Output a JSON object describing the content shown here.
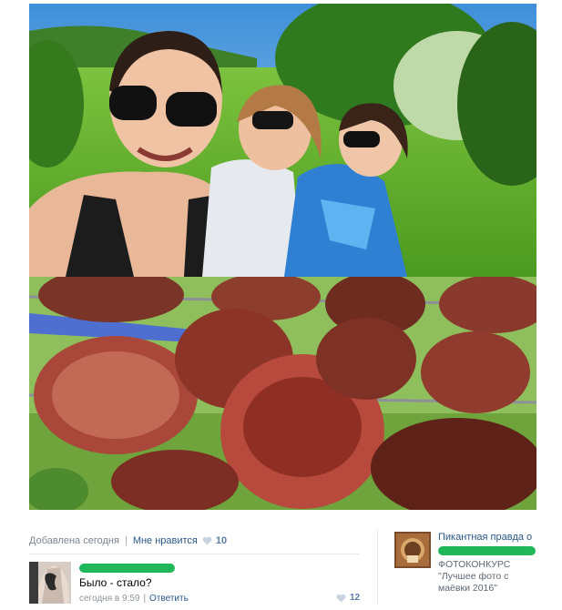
{
  "photos": {
    "top": {
      "description_icon": "selfie-photo"
    },
    "bottom": {
      "description_icon": "kebab-photo"
    }
  },
  "post_meta": {
    "added": "Добавлена сегодня",
    "separator": "|",
    "like_label": "Мне нравится",
    "like_count": "10"
  },
  "comment": {
    "text": "Было - стало?",
    "time": "сегодня в 9:59",
    "separator": "|",
    "reply": "Ответить",
    "likes": "12"
  },
  "group": {
    "title": "Пикантная правда о",
    "caption_line1": "ФОТОКОНКУРС",
    "caption_line2": "\"Лучшее фото с",
    "caption_line3": "маёвки 2016\""
  },
  "colors": {
    "link": "#2a5885",
    "meta_gray": "#7b8590",
    "redaction_green": "#1fb757"
  }
}
